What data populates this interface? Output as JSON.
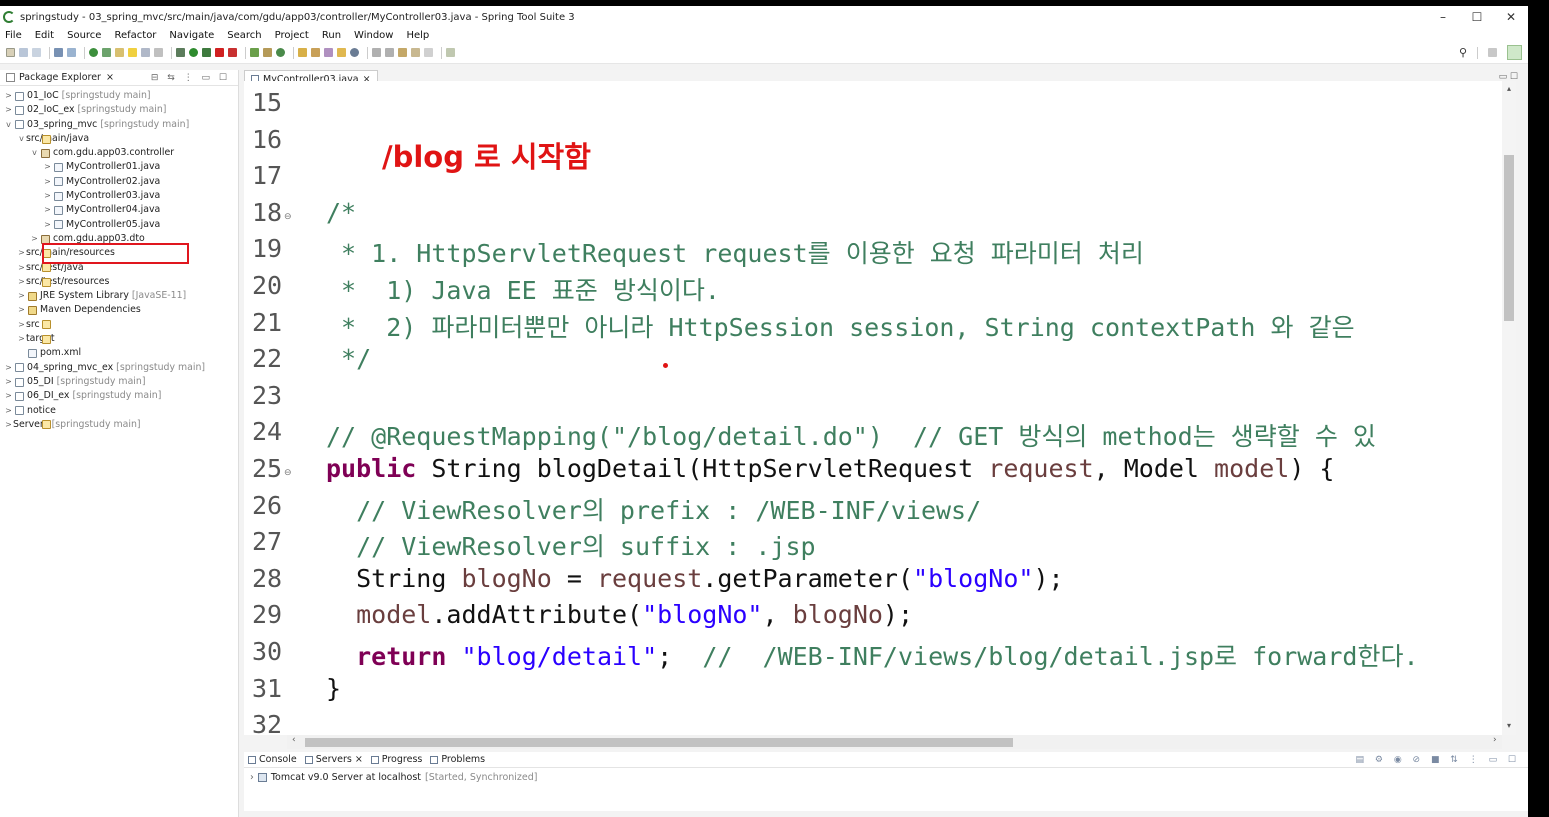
{
  "window": {
    "title": "springstudy - 03_spring_mvc/src/main/java/com/gdu/app03/controller/MyController03.java - Spring Tool Suite 3",
    "controls": [
      "–",
      "☐",
      "✕"
    ]
  },
  "menu": [
    "File",
    "Edit",
    "Source",
    "Refactor",
    "Navigate",
    "Search",
    "Project",
    "Run",
    "Window",
    "Help"
  ],
  "explorer": {
    "tab_label": "Package Explorer",
    "items": [
      {
        "arrow": ">",
        "icon": "project",
        "label": "01_IoC",
        "dim": "[springstudy main]"
      },
      {
        "arrow": ">",
        "icon": "project",
        "label": "02_IoC_ex",
        "dim": "[springstudy main]"
      },
      {
        "arrow": "v",
        "icon": "project",
        "label": "03_spring_mvc",
        "dim": "[springstudy main]"
      },
      {
        "arrow": "v",
        "icon": "source-folder",
        "label": "src/main/java",
        "dim": ""
      },
      {
        "arrow": "v",
        "icon": "package",
        "label": "com.gdu.app03.controller",
        "dim": ""
      },
      {
        "arrow": ">",
        "icon": "java-file",
        "label": "MyController01.java",
        "dim": ""
      },
      {
        "arrow": ">",
        "icon": "java-file",
        "label": "MyController02.java",
        "dim": ""
      },
      {
        "arrow": ">",
        "icon": "java-file",
        "label": "MyController03.java",
        "dim": ""
      },
      {
        "arrow": ">",
        "icon": "java-file",
        "label": "MyController04.java",
        "dim": ""
      },
      {
        "arrow": ">",
        "icon": "java-file",
        "label": "MyController05.java",
        "dim": ""
      },
      {
        "arrow": ">",
        "icon": "package",
        "label": "com.gdu.app03.dto",
        "dim": ""
      },
      {
        "arrow": ">",
        "icon": "source-folder",
        "label": "src/main/resources",
        "dim": ""
      },
      {
        "arrow": ">",
        "icon": "source-folder",
        "label": "src/test/java",
        "dim": ""
      },
      {
        "arrow": ">",
        "icon": "source-folder",
        "label": "src/test/resources",
        "dim": ""
      },
      {
        "arrow": ">",
        "icon": "library",
        "label": "JRE System Library",
        "dim": "[JavaSE-11]"
      },
      {
        "arrow": ">",
        "icon": "library",
        "label": "Maven Dependencies",
        "dim": ""
      },
      {
        "arrow": ">",
        "icon": "folder",
        "label": "src",
        "dim": ""
      },
      {
        "arrow": ">",
        "icon": "folder",
        "label": "target",
        "dim": ""
      },
      {
        "arrow": "",
        "icon": "xml-file",
        "label": "pom.xml",
        "dim": ""
      },
      {
        "arrow": ">",
        "icon": "project",
        "label": "04_spring_mvc_ex",
        "dim": "[springstudy main]"
      },
      {
        "arrow": ">",
        "icon": "project",
        "label": "05_DI",
        "dim": "[springstudy main]"
      },
      {
        "arrow": ">",
        "icon": "project",
        "label": "06_DI_ex",
        "dim": "[springstudy main]"
      },
      {
        "arrow": ">",
        "icon": "project",
        "label": "notice",
        "dim": ""
      },
      {
        "arrow": ">",
        "icon": "servers",
        "label": "Servers",
        "dim": "[springstudy main]"
      }
    ]
  },
  "editor": {
    "tab_label": "MyController03.java",
    "annotation": "/blog 로 시작함",
    "lines": [
      {
        "n": "15",
        "fold": "",
        "segs": []
      },
      {
        "n": "16",
        "fold": "",
        "segs": []
      },
      {
        "n": "17",
        "fold": "",
        "segs": []
      },
      {
        "n": "18",
        "fold": "⊖",
        "segs": [
          {
            "c": "cm",
            "t": "/*"
          }
        ]
      },
      {
        "n": "19",
        "fold": "",
        "segs": [
          {
            "c": "cm",
            "t": " * 1. HttpServletRequest request를 이용한 요청 파라미터 처리"
          }
        ]
      },
      {
        "n": "20",
        "fold": "",
        "segs": [
          {
            "c": "cm",
            "t": " *  1) Java EE 표준 방식이다."
          }
        ]
      },
      {
        "n": "21",
        "fold": "",
        "segs": [
          {
            "c": "cm",
            "t": " *  2) 파라미터뿐만 아니라 HttpSession session, String contextPath 와 같은"
          }
        ]
      },
      {
        "n": "22",
        "fold": "",
        "segs": [
          {
            "c": "cm",
            "t": " */"
          }
        ]
      },
      {
        "n": "23",
        "fold": "",
        "segs": []
      },
      {
        "n": "24",
        "fold": "",
        "segs": [
          {
            "c": "cm",
            "t": "// @RequestMapping(\"/blog/detail.do\")  // GET 방식의 method는 생략할 수 있"
          }
        ]
      },
      {
        "n": "25",
        "fold": "⊖",
        "segs": [
          {
            "c": "kw",
            "t": "public"
          },
          {
            "c": "",
            "t": " String blogDetail(HttpServletRequest "
          },
          {
            "c": "vr",
            "t": "request"
          },
          {
            "c": "",
            "t": ", Model "
          },
          {
            "c": "vr",
            "t": "model"
          },
          {
            "c": "",
            "t": ") {"
          }
        ]
      },
      {
        "n": "26",
        "fold": "",
        "segs": [
          {
            "c": "cm",
            "t": "  // ViewResolver의 prefix : /WEB-INF/views/"
          }
        ]
      },
      {
        "n": "27",
        "fold": "",
        "segs": [
          {
            "c": "cm",
            "t": "  // ViewResolver의 suffix : .jsp"
          }
        ]
      },
      {
        "n": "28",
        "fold": "",
        "segs": [
          {
            "c": "",
            "t": "  String "
          },
          {
            "c": "vr",
            "t": "blogNo"
          },
          {
            "c": "",
            "t": " = "
          },
          {
            "c": "vr",
            "t": "request"
          },
          {
            "c": "",
            "t": ".getParameter("
          },
          {
            "c": "st",
            "t": "\"blogNo\""
          },
          {
            "c": "",
            "t": ");"
          }
        ]
      },
      {
        "n": "29",
        "fold": "",
        "segs": [
          {
            "c": "vr",
            "t": "  model"
          },
          {
            "c": "",
            "t": ".addAttribute("
          },
          {
            "c": "st",
            "t": "\"blogNo\""
          },
          {
            "c": "",
            "t": ", "
          },
          {
            "c": "vr",
            "t": "blogNo"
          },
          {
            "c": "",
            "t": ");"
          }
        ]
      },
      {
        "n": "30",
        "fold": "",
        "segs": [
          {
            "c": "kw",
            "t": "  return"
          },
          {
            "c": "",
            "t": " "
          },
          {
            "c": "st",
            "t": "\"blog/detail\""
          },
          {
            "c": "",
            "t": ";  "
          },
          {
            "c": "cm",
            "t": "//  /WEB-INF/views/blog/detail.jsp로 forward한다."
          }
        ]
      },
      {
        "n": "31",
        "fold": "",
        "segs": [
          {
            "c": "",
            "t": "}"
          }
        ]
      },
      {
        "n": "32",
        "fold": "",
        "segs": []
      }
    ]
  },
  "bottom_panel": {
    "tabs": [
      "Console",
      "Servers",
      "Progress",
      "Problems"
    ],
    "server_label": "Tomcat v9.0 Server at localhost",
    "server_status": "[Started, Synchronized]"
  },
  "colors": {
    "annotation": "#e01414",
    "keyword": "#7f0055",
    "comment": "#3f7f5f",
    "string": "#2a00ff"
  }
}
